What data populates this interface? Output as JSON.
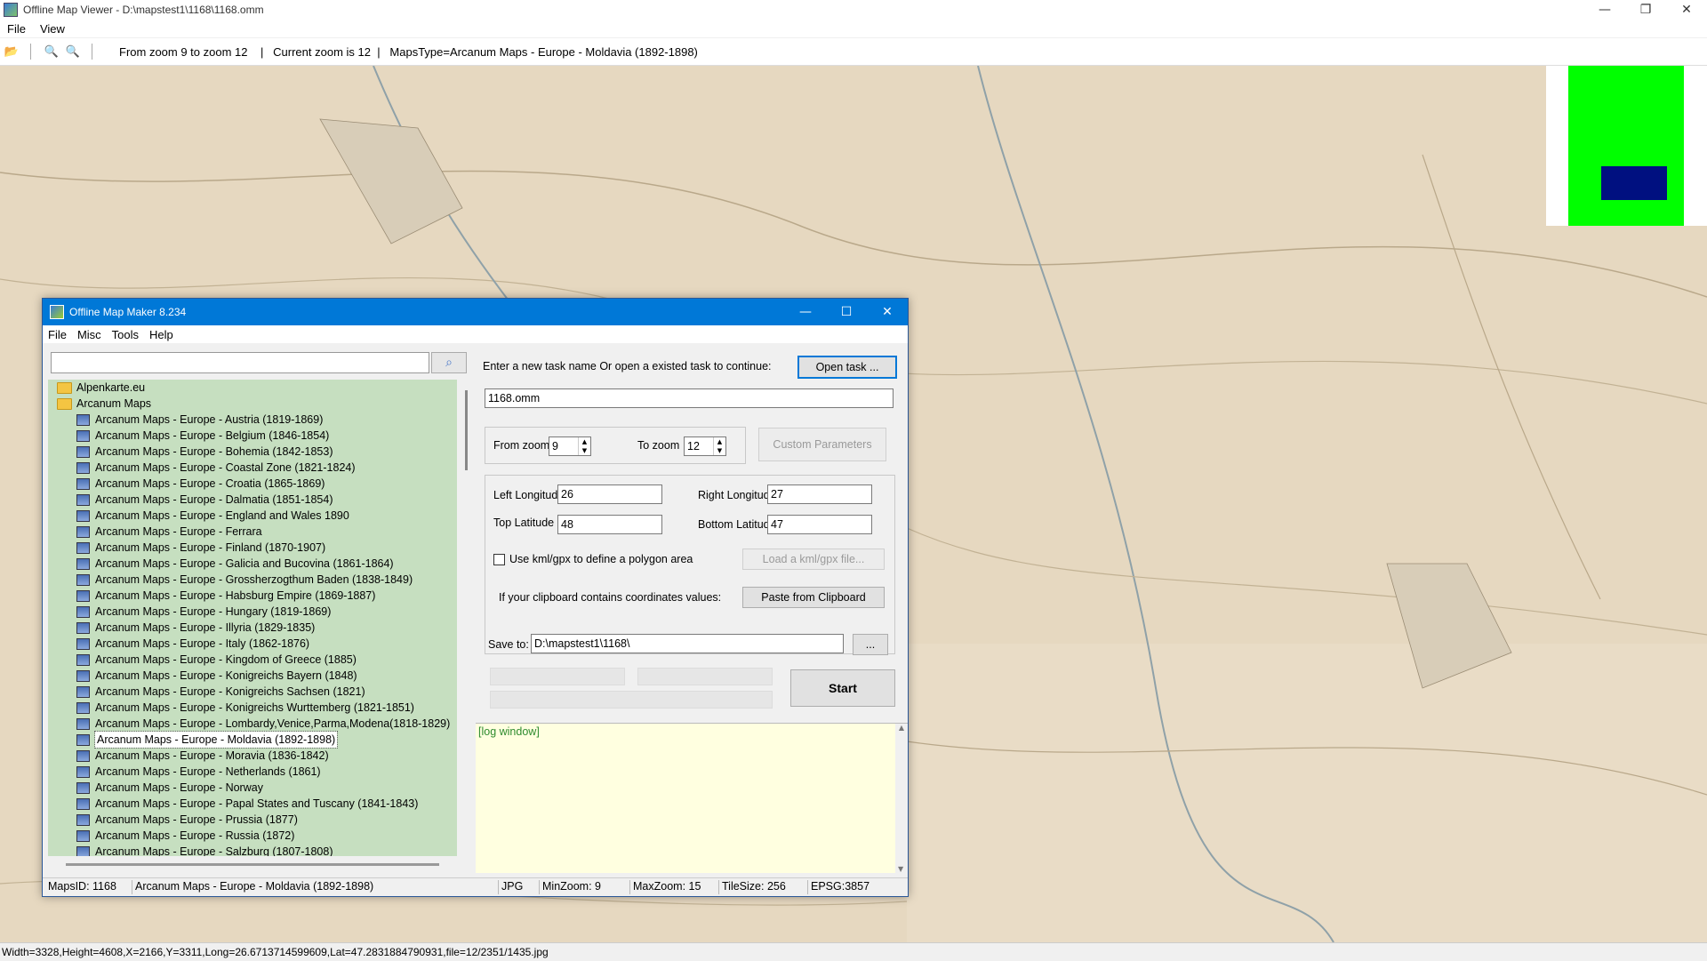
{
  "window": {
    "title": "Offline Map Viewer - D:\\mapstest1\\1168\\1168.omm",
    "minimize": "—",
    "restore": "❐",
    "close": "✕"
  },
  "menu": {
    "file": "File",
    "view": "View"
  },
  "toolbar": {
    "info": "From zoom 9 to zoom 12    |   Current zoom is 12  |   MapsType=Arcanum Maps - Europe - Moldavia (1892-1898)"
  },
  "colors": {
    "map_bg": "#e5d7bf",
    "tree_bg": "#c6dfc0",
    "dialog_title": "#0078d7",
    "minimap_green": "#00ff00",
    "minimap_blue": "#001080"
  },
  "status_bar": {
    "text": "Width=3328,Height=4608,X=2166,Y=3311,Long=26.6713714599609,Lat=47.2831884790931,file=12/2351/1435.jpg"
  },
  "dialog": {
    "title": "Offline Map Maker 8.234",
    "minimize": "—",
    "maximize": "☐",
    "close": "✕",
    "menu": {
      "file": "File",
      "misc": "Misc",
      "tools": "Tools",
      "help": "Help"
    },
    "search": {
      "value": "",
      "icon": "search-icon"
    },
    "tree": [
      {
        "label": "Alpenkarte.eu",
        "type": "folder"
      },
      {
        "label": "Arcanum Maps",
        "type": "folder"
      },
      {
        "label": "Arcanum Maps - Europe - Austria (1819-1869)",
        "type": "map"
      },
      {
        "label": "Arcanum Maps - Europe - Belgium (1846-1854)",
        "type": "map"
      },
      {
        "label": "Arcanum Maps - Europe - Bohemia (1842-1853)",
        "type": "map"
      },
      {
        "label": "Arcanum Maps - Europe - Coastal Zone (1821-1824)",
        "type": "map"
      },
      {
        "label": "Arcanum Maps - Europe - Croatia (1865-1869)",
        "type": "map"
      },
      {
        "label": "Arcanum Maps - Europe - Dalmatia (1851-1854)",
        "type": "map"
      },
      {
        "label": "Arcanum Maps - Europe - England and Wales 1890",
        "type": "map"
      },
      {
        "label": "Arcanum Maps - Europe - Ferrara",
        "type": "map"
      },
      {
        "label": "Arcanum Maps - Europe - Finland (1870-1907)",
        "type": "map"
      },
      {
        "label": "Arcanum Maps - Europe - Galicia and Bucovina (1861-1864)",
        "type": "map"
      },
      {
        "label": "Arcanum Maps - Europe - Grossherzogthum Baden (1838-1849)",
        "type": "map"
      },
      {
        "label": "Arcanum Maps - Europe - Habsburg Empire (1869-1887)",
        "type": "map"
      },
      {
        "label": "Arcanum Maps - Europe - Hungary (1819-1869)",
        "type": "map"
      },
      {
        "label": "Arcanum Maps - Europe - Illyria (1829-1835)",
        "type": "map"
      },
      {
        "label": "Arcanum Maps - Europe - Italy (1862-1876)",
        "type": "map"
      },
      {
        "label": "Arcanum Maps - Europe - Kingdom of Greece (1885)",
        "type": "map"
      },
      {
        "label": "Arcanum Maps - Europe - Konigreichs Bayern (1848)",
        "type": "map"
      },
      {
        "label": "Arcanum Maps - Europe - Konigreichs Sachsen (1821)",
        "type": "map"
      },
      {
        "label": "Arcanum Maps - Europe - Konigreichs Wurttemberg (1821-1851)",
        "type": "map"
      },
      {
        "label": "Arcanum Maps - Europe - Lombardy,Venice,Parma,Modena(1818-1829)",
        "type": "map"
      },
      {
        "label": "Arcanum Maps - Europe - Moldavia (1892-1898)",
        "type": "map",
        "selected": true
      },
      {
        "label": "Arcanum Maps - Europe - Moravia (1836-1842)",
        "type": "map"
      },
      {
        "label": "Arcanum Maps - Europe - Netherlands (1861)",
        "type": "map"
      },
      {
        "label": "Arcanum Maps - Europe - Norway",
        "type": "map"
      },
      {
        "label": "Arcanum Maps - Europe - Papal States and Tuscany (1841-1843)",
        "type": "map"
      },
      {
        "label": "Arcanum Maps - Europe - Prussia (1877)",
        "type": "map"
      },
      {
        "label": "Arcanum Maps - Europe - Russia (1872)",
        "type": "map"
      },
      {
        "label": "Arcanum Maps - Europe - Salzburg (1807-1808)",
        "type": "map"
      }
    ],
    "task_prompt": "Enter a new task name Or open a existed task to continue:",
    "open_task": "Open task ...",
    "task_name": "1168.omm",
    "from_zoom_label": "From zoom",
    "from_zoom": "9",
    "to_zoom_label": "To zoom",
    "to_zoom": "12",
    "custom_params": "Custom Parameters",
    "left_lon_label": "Left Longitude",
    "left_lon": "26",
    "right_lon_label": "Right Longitude",
    "right_lon": "27",
    "top_lat_label": "Top Latitude",
    "top_lat": "48",
    "bottom_lat_label": "Bottom Latitude",
    "bottom_lat": "47",
    "kml_label": "Use kml/gpx to define a polygon area",
    "load_kml": "Load a kml/gpx file...",
    "clipboard_label": "If your clipboard contains coordinates values:",
    "paste_clipboard": "Paste from Clipboard",
    "save_to_label": "Save to:",
    "save_to": "D:\\mapstest1\\1168\\",
    "browse": "...",
    "start": "Start",
    "log": "[log window]",
    "status": {
      "maps_id": "MapsID: 1168",
      "map_name": "Arcanum Maps - Europe - Moldavia (1892-1898)",
      "format": "JPG",
      "min_zoom": "MinZoom: 9",
      "max_zoom": "MaxZoom: 15",
      "tile_size": "TileSize: 256",
      "epsg": "EPSG:3857"
    }
  }
}
